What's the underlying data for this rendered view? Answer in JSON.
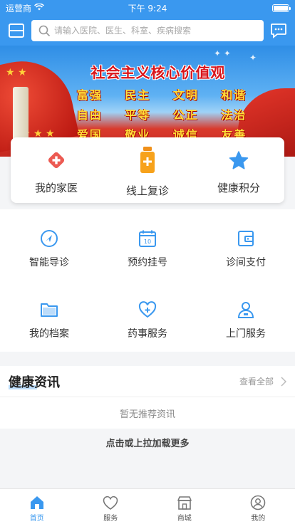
{
  "status_bar": {
    "carrier": "运营商",
    "time": "下午 9:24"
  },
  "header": {
    "search_placeholder": "请输入医院、医生、科室、疾病搜索"
  },
  "banner": {
    "title": "社会主义核心价值观",
    "values": [
      "富强",
      "民主",
      "文明",
      "和谐",
      "自由",
      "平等",
      "公正",
      "法治",
      "爱国",
      "敬业",
      "诚信",
      "友善"
    ]
  },
  "quick_card": {
    "items": [
      {
        "label": "我的家医",
        "icon": "medical-cross-icon"
      },
      {
        "label": "线上复诊",
        "icon": "medicine-bottle-icon"
      },
      {
        "label": "健康积分",
        "icon": "star-icon"
      }
    ]
  },
  "services": {
    "items": [
      {
        "label": "智能导诊",
        "icon": "navigation-icon"
      },
      {
        "label": "预约挂号",
        "icon": "calendar-icon"
      },
      {
        "label": "诊间支付",
        "icon": "wallet-icon"
      },
      {
        "label": "我的档案",
        "icon": "folder-icon"
      },
      {
        "label": "药事服务",
        "icon": "heart-plus-icon"
      },
      {
        "label": "上门服务",
        "icon": "doctor-icon"
      }
    ]
  },
  "news": {
    "title": "健康资讯",
    "see_all": "查看全部",
    "empty_text": "暂无推荐资讯"
  },
  "load_more": "点击或上拉加载更多",
  "tabbar": {
    "tabs": [
      {
        "label": "首页",
        "icon": "home-icon",
        "active": true
      },
      {
        "label": "服务",
        "icon": "heart-icon",
        "active": false
      },
      {
        "label": "商城",
        "icon": "shop-icon",
        "active": false
      },
      {
        "label": "我的",
        "icon": "user-icon",
        "active": false
      }
    ]
  },
  "colors": {
    "primary": "#3a98ef",
    "accent_red": "#e8534b",
    "accent_orange": "#f7a21b"
  }
}
